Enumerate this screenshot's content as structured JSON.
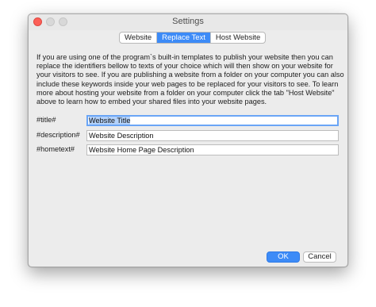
{
  "window": {
    "title": "Settings"
  },
  "tabs": [
    {
      "label": "Website",
      "active": false
    },
    {
      "label": "Replace Text",
      "active": true
    },
    {
      "label": "Host Website",
      "active": false
    }
  ],
  "description": "If you are using one of the program`s built-in templates to publish your website then you can replace the identifiers bellow to texts of your choice which will then show on your website for your visitors to see. If you are publishing a website from a folder on your computer you can also include these keywords inside your web pages to be replaced for your visitors to see. To learn more about hosting your website from a folder on your computer click the tab \"Host Website\" above to learn how to embed your shared files into your website pages.",
  "fields": [
    {
      "label": "#title#",
      "value": "Website Title"
    },
    {
      "label": "#description#",
      "value": "Website Description"
    },
    {
      "label": "#hometext#",
      "value": "Website Home Page Description"
    }
  ],
  "buttons": {
    "ok": "OK",
    "cancel": "Cancel"
  },
  "colors": {
    "accent": "#3d8bf7",
    "close": "#fc5f57"
  }
}
